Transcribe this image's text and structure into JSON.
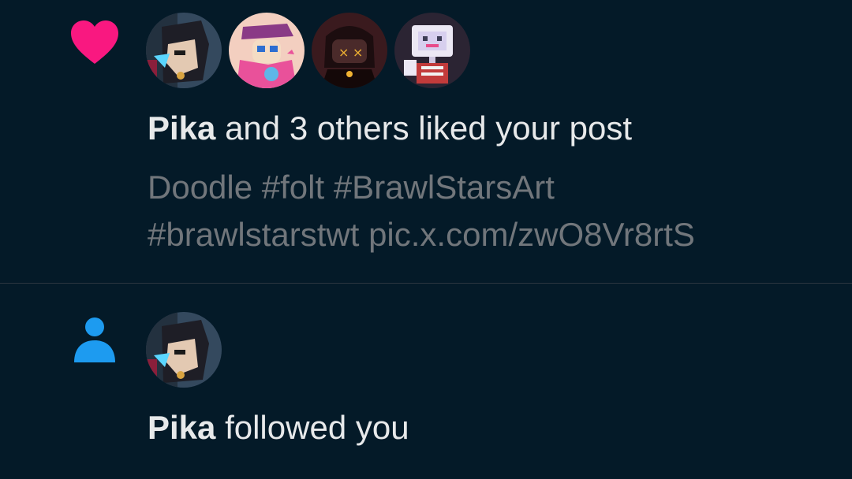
{
  "notifications": [
    {
      "type": "like",
      "icon": "heart-icon",
      "icon_color": "#f91880",
      "actor": "Pika",
      "text": " and 3 others liked your post",
      "post_preview_line1": "Doodle #folt #BrawlStarsArt",
      "post_preview_line2": "#brawlstarstwt pic.x.com/zwO8Vr8rtS",
      "avatars": [
        "avatar-pika",
        "avatar-2",
        "avatar-3",
        "avatar-4"
      ]
    },
    {
      "type": "follow",
      "icon": "person-icon",
      "icon_color": "#1d9bf0",
      "actor": "Pika",
      "text": " followed you",
      "avatars": [
        "avatar-pika"
      ]
    }
  ],
  "theme": {
    "background": "#041a28",
    "primary_text": "#e7e9ea",
    "secondary_text": "#71767b",
    "divider": "#2b3640"
  }
}
